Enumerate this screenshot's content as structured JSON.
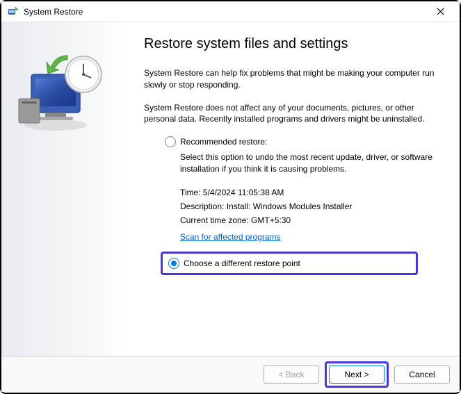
{
  "titlebar": {
    "title": "System Restore"
  },
  "main": {
    "heading": "Restore system files and settings",
    "para1": "System Restore can help fix problems that might be making your computer run slowly or stop responding.",
    "para2": "System Restore does not affect any of your documents, pictures, or other personal data. Recently installed programs and drivers might be uninstalled.",
    "option1": {
      "label": "Recommended restore:",
      "desc": "Select this option to undo the most recent update, driver, or software installation if you think it is causing problems.",
      "time_label": "Time: ",
      "time_value": "5/4/2024 11:05:38 AM",
      "desc_label": "Description: ",
      "desc_value": "Install: Windows Modules Installer",
      "tz_label": "Current time zone: ",
      "tz_value": "GMT+5:30",
      "scan_link": "Scan for affected programs"
    },
    "option2": {
      "label": "Choose a different restore point"
    }
  },
  "footer": {
    "back": "< Back",
    "next": "Next >",
    "cancel": "Cancel"
  }
}
